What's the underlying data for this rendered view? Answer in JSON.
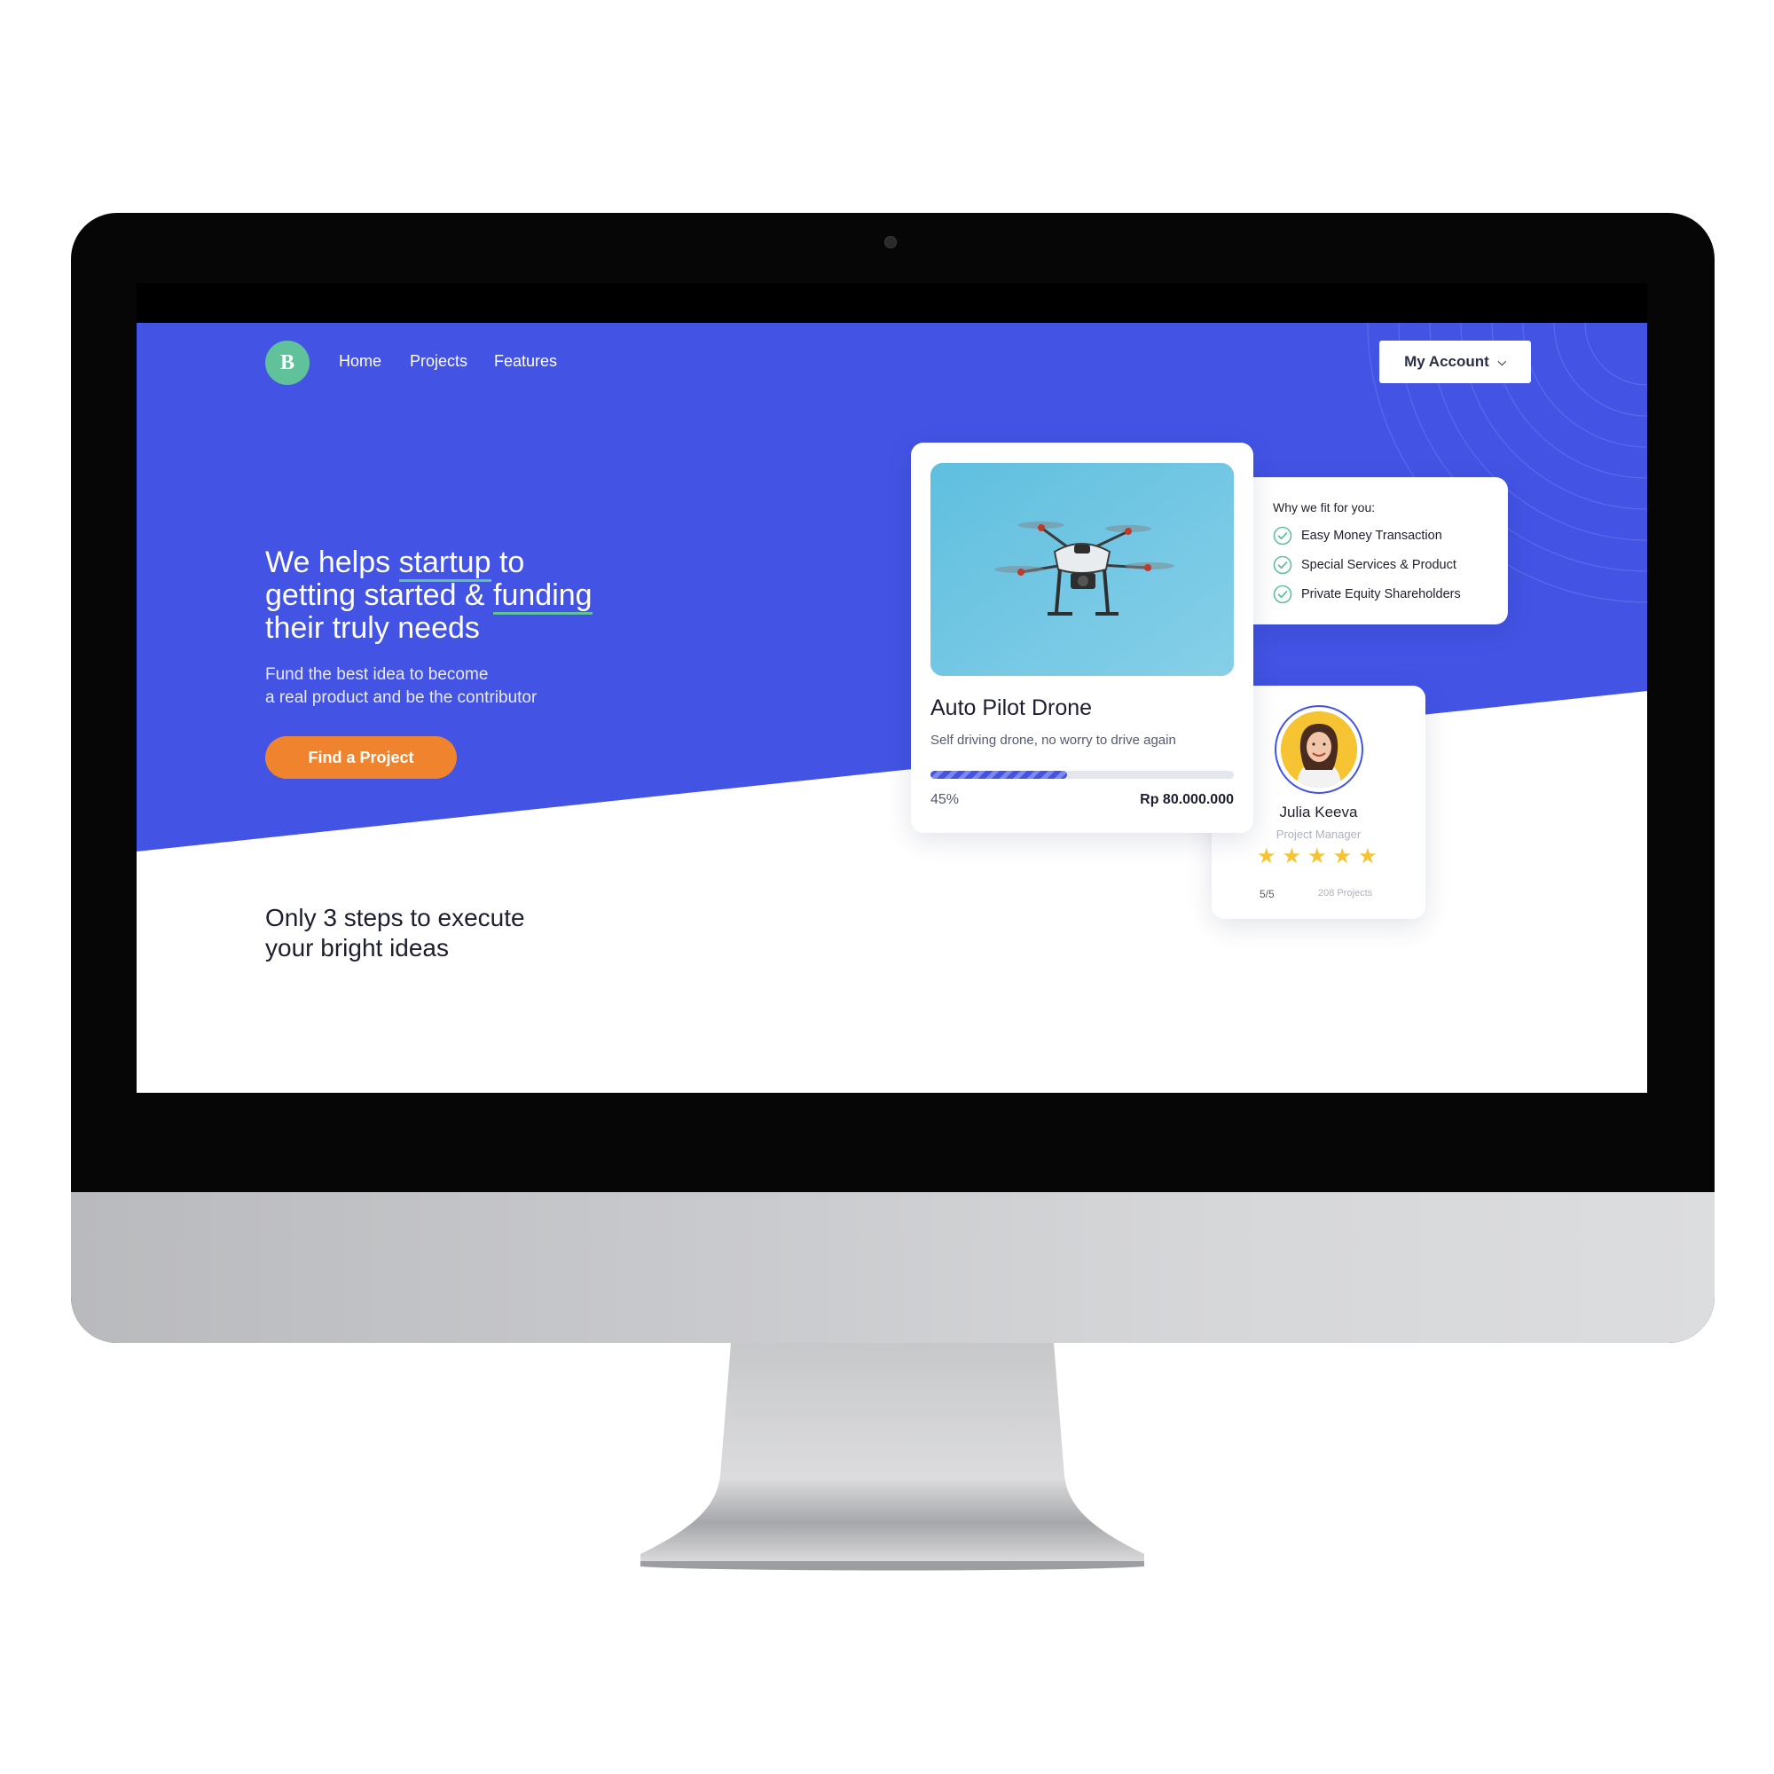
{
  "nav": {
    "logo_letter": "B",
    "links": [
      "Home",
      "Projects",
      "Features"
    ],
    "account_label": "My Account"
  },
  "hero": {
    "title_line1_pre": "We helps ",
    "title_line1_hl": "startup",
    "title_line1_post": " to",
    "title_line2_pre": "getting started & ",
    "title_line2_hl": "funding",
    "title_line3": "their truly needs",
    "subtitle_line1": "Fund the best idea to become",
    "subtitle_line2": "a real product and be the contributor",
    "cta_label": "Find a Project"
  },
  "project_card": {
    "image_icon": "drone-photo",
    "title": "Auto Pilot Drone",
    "description": "Self driving drone, no worry to drive again",
    "progress_percent": 45,
    "progress_label": "45%",
    "amount": "Rp 80.000.000"
  },
  "fit_card": {
    "heading": "Why we fit for you:",
    "items": [
      "Easy Money Transaction",
      "Special Services & Product",
      "Private Equity Shareholders"
    ]
  },
  "profile_card": {
    "name": "Julia Keeva",
    "role": "Project Manager",
    "stars": 5,
    "rating": "5/5",
    "projects": "208 Projects"
  },
  "steps": {
    "title_line1": "Only 3 steps to execute",
    "title_line2": "your bright ideas"
  },
  "colors": {
    "primary": "#4353e4",
    "accent_green": "#5fc29a",
    "cta_orange": "#f0842e",
    "star_yellow": "#f6c433"
  }
}
